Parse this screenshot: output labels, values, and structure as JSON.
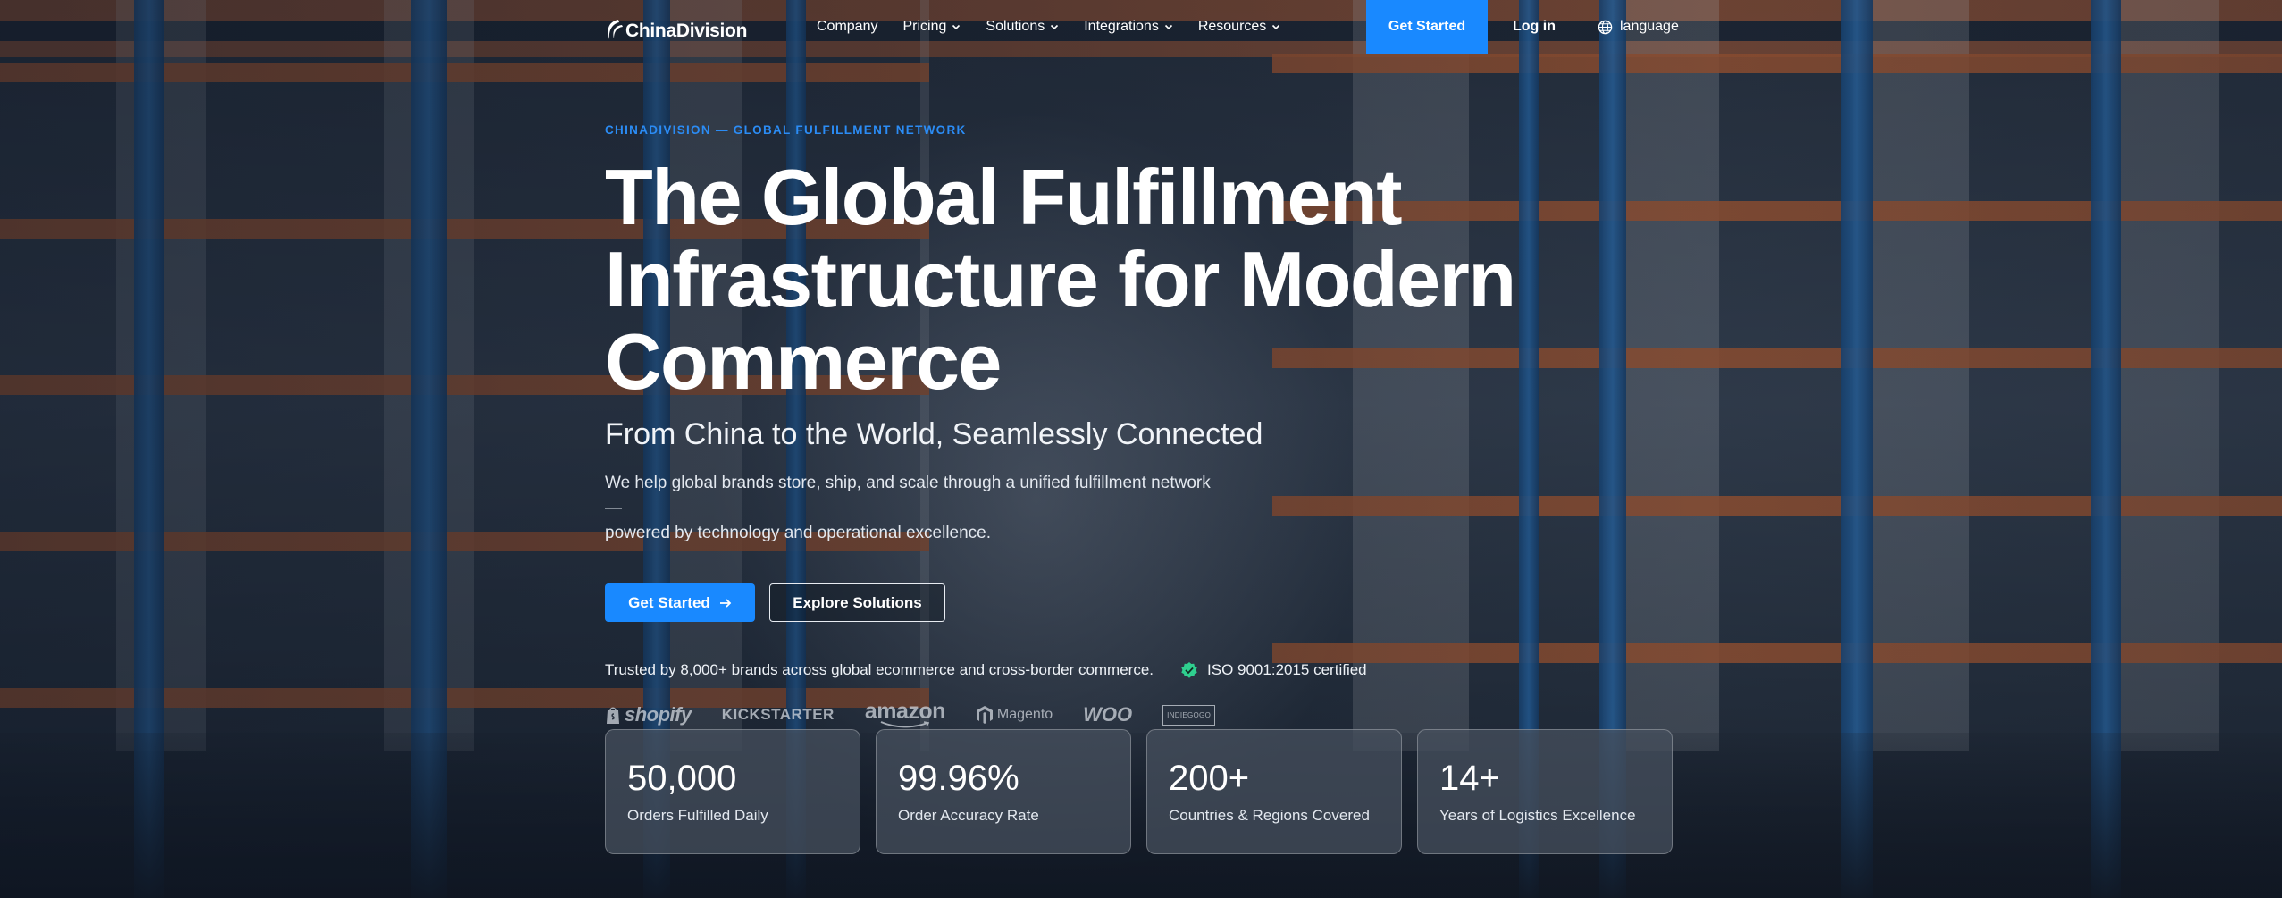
{
  "header": {
    "logo_text": "ChinaDivision",
    "nav": [
      {
        "label": "Company",
        "has_dropdown": false
      },
      {
        "label": "Pricing",
        "has_dropdown": true
      },
      {
        "label": "Solutions",
        "has_dropdown": true
      },
      {
        "label": "Integrations",
        "has_dropdown": true
      },
      {
        "label": "Resources",
        "has_dropdown": true
      }
    ],
    "get_started_label": "Get Started",
    "login_label": "Log in",
    "language_label": "language"
  },
  "hero": {
    "eyebrow": "CHINADIVISION — GLOBAL FULFILLMENT NETWORK",
    "headline_line1": "The Global Fulfillment",
    "headline_line2": "Infrastructure for Modern",
    "headline_line3": "Commerce",
    "subheadline": "From China to the World, Seamlessly Connected",
    "description_line1": "We help global brands store, ship, and scale through a unified fulfillment network —",
    "description_line2": "powered by technology and operational excellence.",
    "primary_cta": "Get Started",
    "secondary_cta": "Explore Solutions",
    "trust_text": "Trusted by 8,000+ brands across global ecommerce and cross-border commerce.",
    "certification": "ISO 9001:2015 certified"
  },
  "brands": [
    {
      "name": "shopify"
    },
    {
      "name": "KICKSTARTER"
    },
    {
      "name": "amazon"
    },
    {
      "name": "Magento"
    },
    {
      "name": "WOO"
    },
    {
      "name": "INDIEGOGO"
    }
  ],
  "stats": [
    {
      "value": "50,000",
      "label": "Orders Fulfilled Daily"
    },
    {
      "value": "99.96%",
      "label": "Order Accuracy Rate"
    },
    {
      "value": "200+",
      "label": "Countries & Regions Covered"
    },
    {
      "value": "14+",
      "label": "Years of Logistics Excellence"
    }
  ],
  "colors": {
    "accent": "#1989ff",
    "eyebrow": "#2b8cf5",
    "cert_badge": "#2fcf8f"
  }
}
